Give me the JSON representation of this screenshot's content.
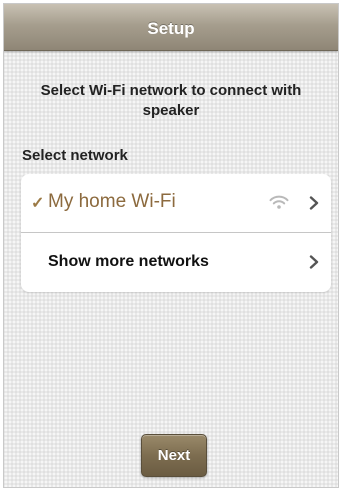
{
  "header": {
    "title": "Setup"
  },
  "instruction": "Select Wi-Fi network to connect with speaker",
  "network_section": {
    "label": "Select network",
    "items": [
      {
        "label": "My home Wi-Fi",
        "selected": true,
        "check_mark": "✓",
        "icon": "wifi-icon",
        "trailing_icon": "chevron-right-icon"
      },
      {
        "label": "Show more networks",
        "selected": false,
        "trailing_icon": "chevron-right-icon"
      }
    ]
  },
  "footer": {
    "next_label": "Next"
  },
  "colors": {
    "accent": "#8c6a3e",
    "header": "#a69e8e",
    "button": "#7d6d50"
  }
}
